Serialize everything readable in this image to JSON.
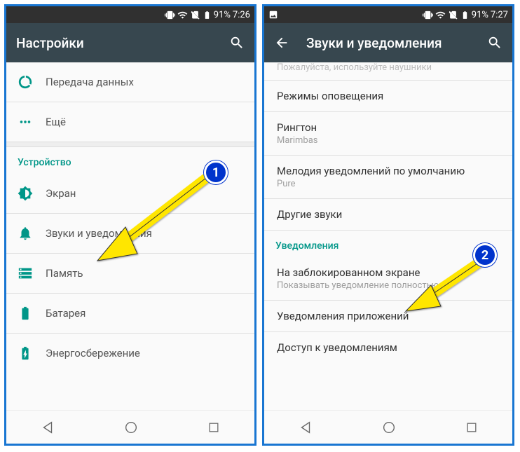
{
  "left": {
    "status": {
      "battery": "91%",
      "time": "7:26"
    },
    "toolbar": {
      "title": "Настройки"
    },
    "items": {
      "data": "Передача данных",
      "more": "Ещё",
      "section_device": "Устройство",
      "display": "Экран",
      "sound": "Звуки и уведомления",
      "memory": "Память",
      "battery": "Батарея",
      "power": "Энергосбережение"
    }
  },
  "right": {
    "status": {
      "battery": "91%",
      "time": "7:27"
    },
    "toolbar": {
      "title": "Звуки и уведомления"
    },
    "partial_sub": "Пожалуйста, используйте наушники",
    "items": {
      "alert_modes": "Режимы оповещения",
      "ringtone": "Рингтон",
      "ringtone_sub": "Marimbas",
      "notif_sound": "Мелодия уведомлений по умолчанию",
      "notif_sound_sub": "Pure",
      "other_sounds": "Другие звуки",
      "section_notif": "Уведомления",
      "lockscreen": "На заблокированном экране",
      "lockscreen_sub": "Показывать уведомление полностью",
      "app_notif": "Уведомления приложений",
      "notif_access": "Доступ к уведомлениям"
    }
  },
  "callouts": {
    "one": "1",
    "two": "2"
  }
}
